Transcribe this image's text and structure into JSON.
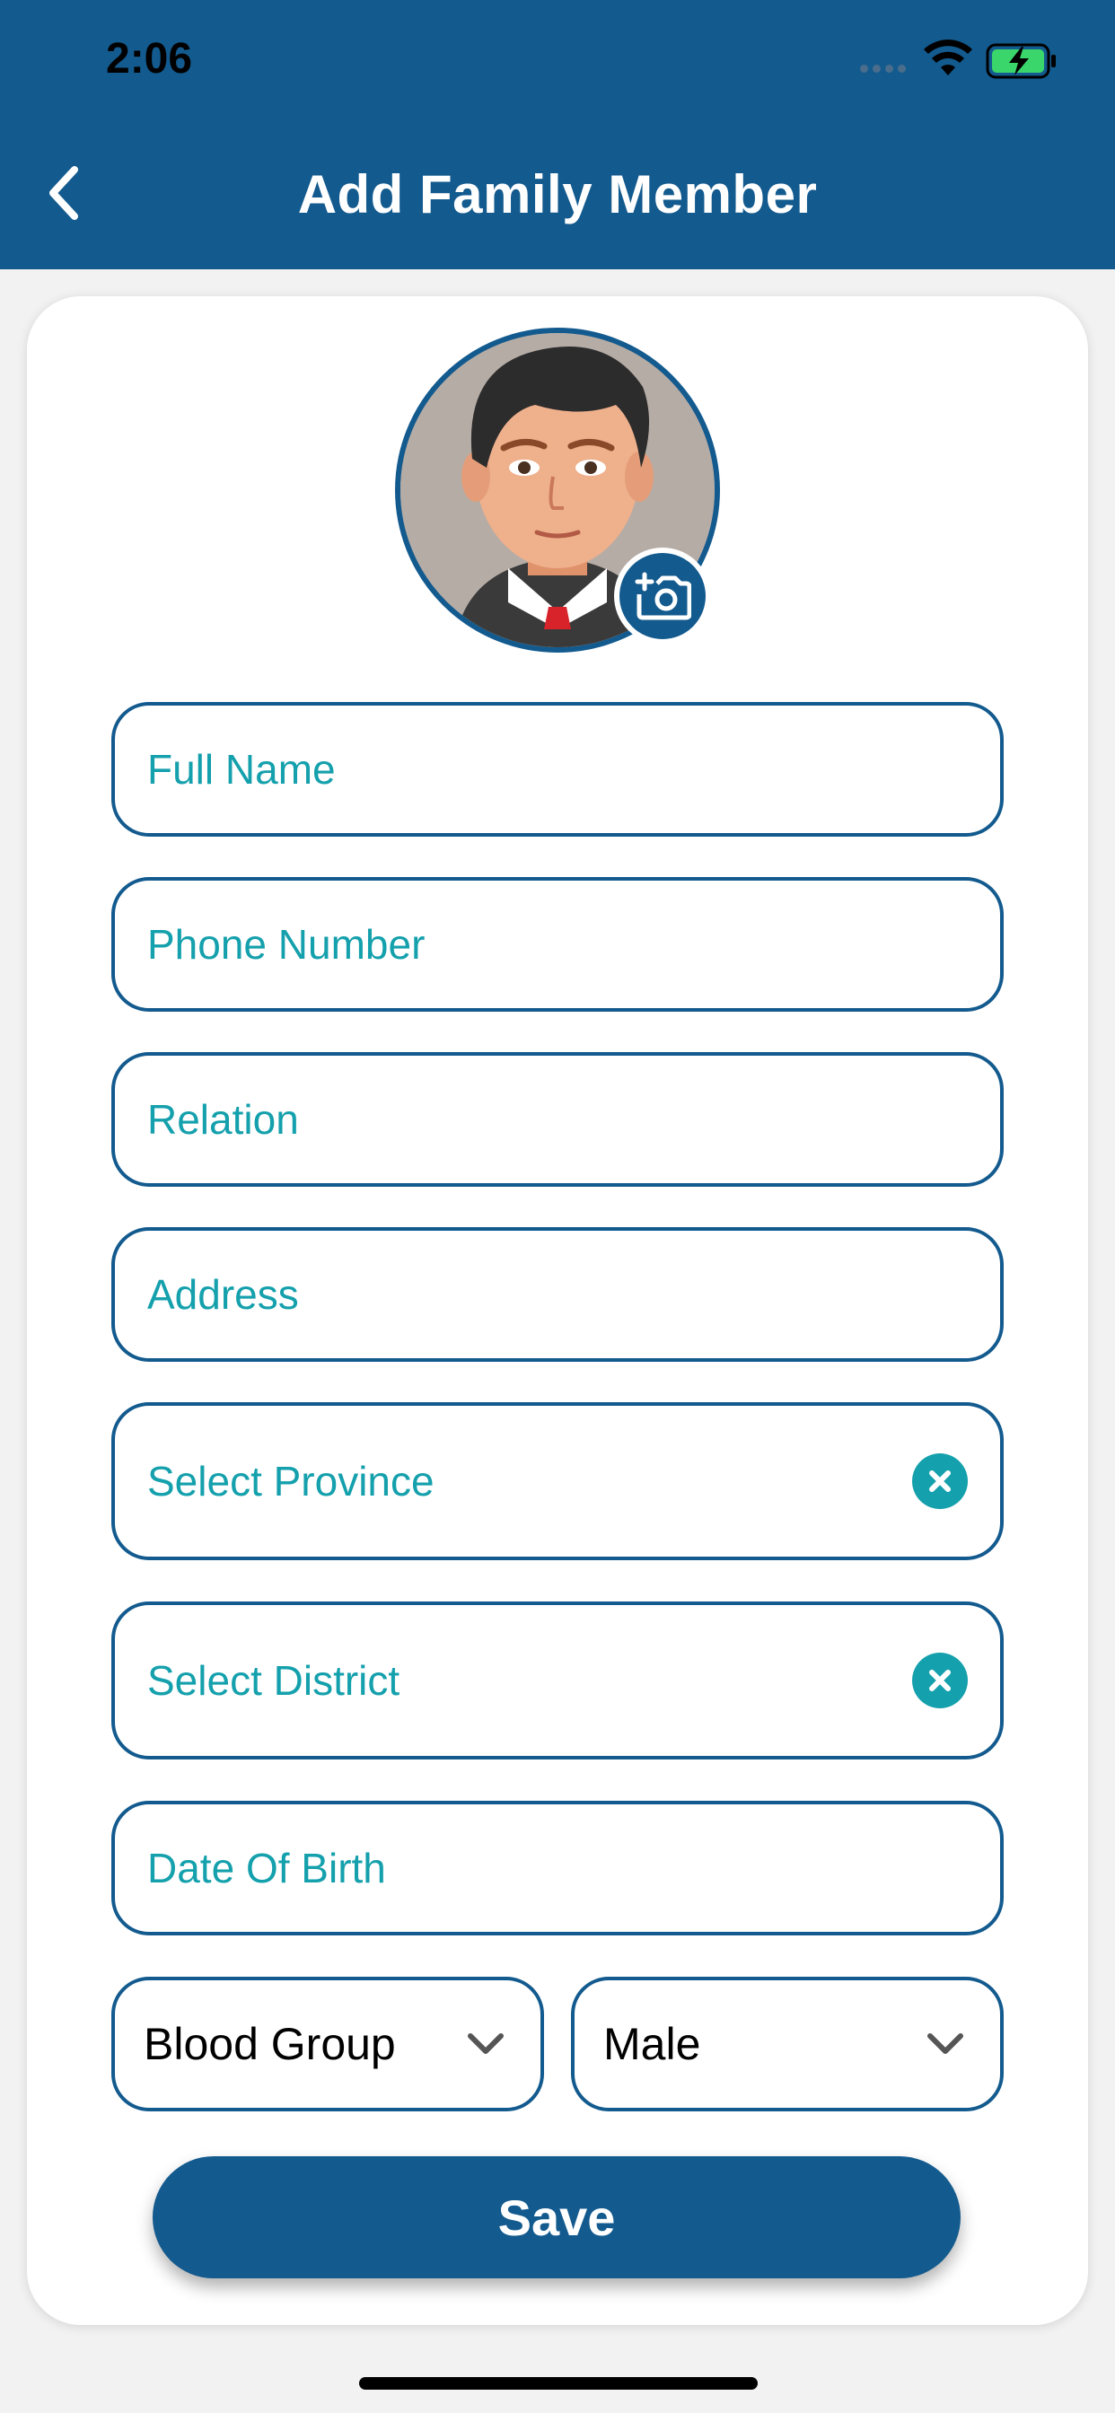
{
  "status_bar": {
    "time": "2:06"
  },
  "header": {
    "title": "Add Family Member",
    "back_icon": "chevron-left-icon"
  },
  "avatar": {
    "camera_icon": "add-photo-icon"
  },
  "form": {
    "full_name": {
      "placeholder": "Full Name"
    },
    "phone_number": {
      "placeholder": "Phone Number"
    },
    "relation": {
      "placeholder": "Relation"
    },
    "address": {
      "placeholder": "Address"
    },
    "province": {
      "placeholder": "Select Province"
    },
    "district": {
      "placeholder": "Select District"
    },
    "date_of_birth": {
      "placeholder": "Date Of Birth"
    },
    "blood_group": {
      "value": "Blood Group"
    },
    "gender": {
      "value": "Male"
    }
  },
  "actions": {
    "save_label": "Save"
  },
  "colors": {
    "primary": "#135a8e",
    "accent": "#14a0ac",
    "background": "#f2f2f2"
  }
}
